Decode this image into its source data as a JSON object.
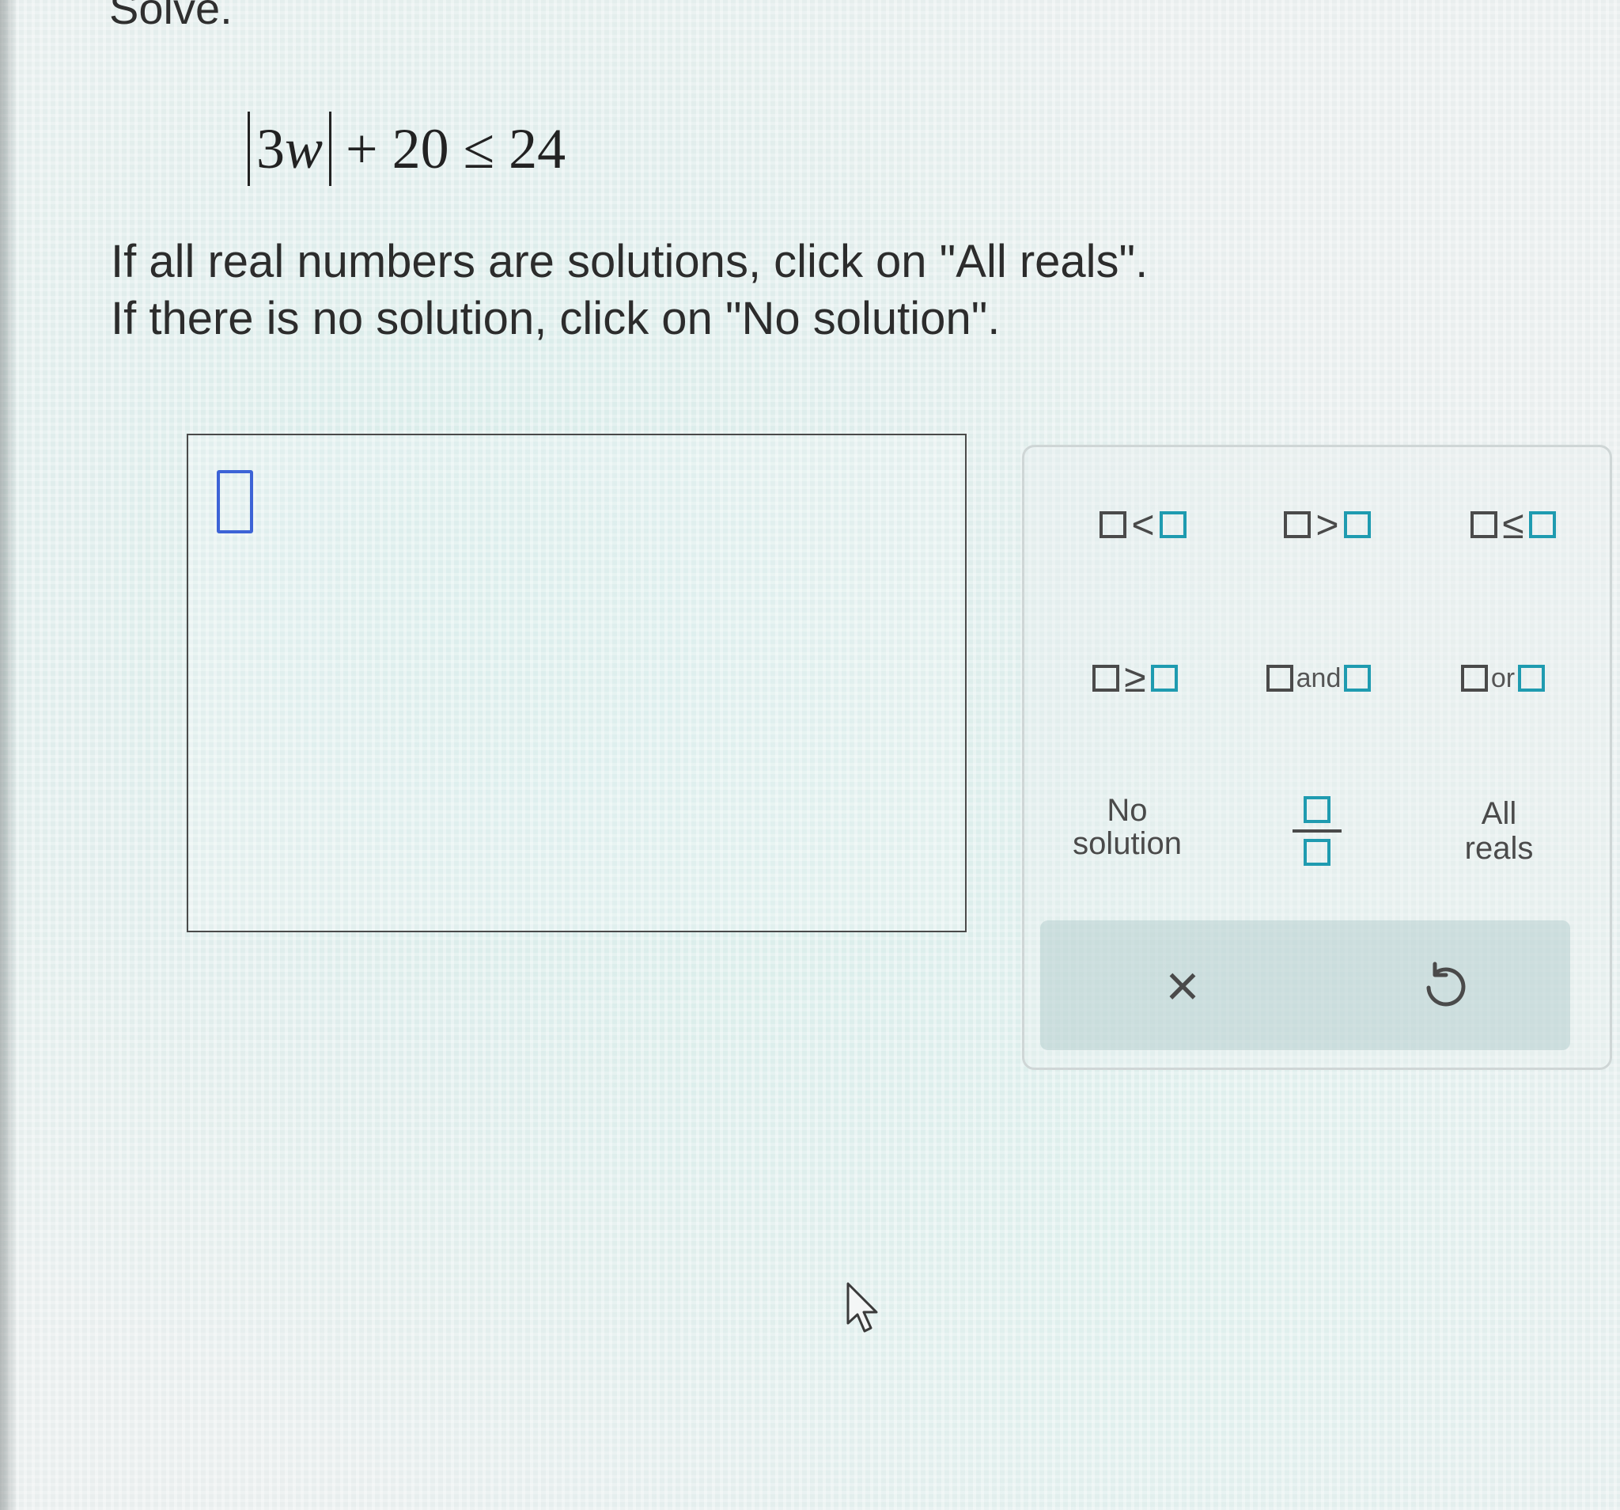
{
  "problem": {
    "heading": "Solve.",
    "equation": {
      "abs_coefficient": "3",
      "abs_variable": "w",
      "rest": "+ 20 ≤ 24"
    },
    "instructions": [
      "If all real numbers are solutions, click on \"All reals\".",
      "If there is no solution, click on \"No solution\"."
    ]
  },
  "keypad": {
    "operators": {
      "less_than": "<",
      "greater_than": ">",
      "less_equal": "≤",
      "greater_equal": "≥",
      "and": "and",
      "or": "or"
    },
    "no_solution": [
      "No",
      "solution"
    ],
    "all_reals": [
      "All",
      "reals"
    ],
    "clear": "×",
    "undo_icon": "undo-icon"
  },
  "colors": {
    "accent_teal": "#1f9bb0",
    "cursor_blue": "#3c63d6"
  }
}
